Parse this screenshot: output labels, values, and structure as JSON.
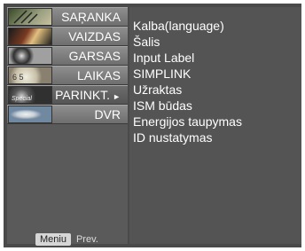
{
  "menu": {
    "items": [
      {
        "label": "SAŖANKA",
        "icon": "antenna-thumb-icon"
      },
      {
        "label": "VAIZDAS",
        "icon": "picture-thumb-icon"
      },
      {
        "label": "GARSAS",
        "icon": "speaker-thumb-icon"
      },
      {
        "label": "LAIKAS",
        "icon": "clock-thumb-icon"
      },
      {
        "label": "PARINKT.",
        "icon": "special-thumb-icon"
      },
      {
        "label": "DVR",
        "icon": "disc-thumb-icon"
      }
    ],
    "active_index": 4
  },
  "options": [
    "Kalba(language)",
    "Šalis",
    "Input Label",
    "SIMPLINK",
    "Užraktas",
    "ISM būdas",
    "Energijos taupymas",
    "ID nustatymas"
  ],
  "footer": {
    "menu_label": "Meniu",
    "prev_label": "Prev."
  },
  "colors": {
    "panel": "#4a4a4a",
    "text": "#ffffff"
  }
}
